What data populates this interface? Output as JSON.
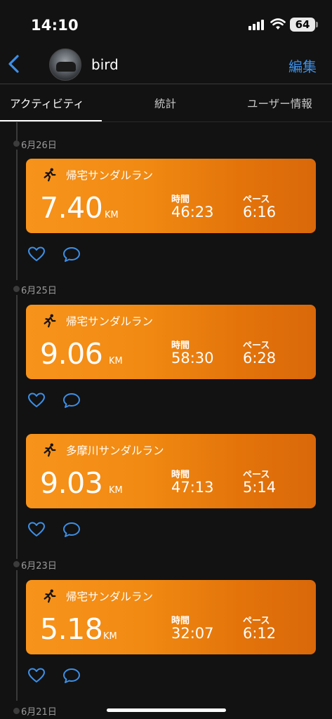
{
  "status_bar": {
    "time": "14:10",
    "battery": "64"
  },
  "header": {
    "username": "bird",
    "edit_label": "編集"
  },
  "tabs": [
    {
      "label": "アクティビティ",
      "active": true
    },
    {
      "label": "統計",
      "active": false
    },
    {
      "label": "ユーザー情報",
      "active": false
    }
  ],
  "labels": {
    "time": "時間",
    "pace": "ペース",
    "unit": "KM"
  },
  "dates": [
    "6月26日",
    "6月25日",
    "6月23日",
    "6月21日"
  ],
  "activities": [
    {
      "title": "帰宅サンダルラン",
      "distance": "7.40",
      "time": "46:23",
      "pace": "6:16"
    },
    {
      "title": "帰宅サンダルラン",
      "distance": "9.06",
      "time": "58:30",
      "pace": "6:28"
    },
    {
      "title": "多摩川サンダルラン",
      "distance": "9.03",
      "time": "47:13",
      "pace": "5:14"
    },
    {
      "title": "帰宅サンダルラン",
      "distance": "5.18",
      "time": "32:07",
      "pace": "6:12"
    }
  ],
  "colors": {
    "accent": "#3d8fe6",
    "card": "#f18a12",
    "background": "#121212"
  },
  "icons": [
    "back-chevron-icon",
    "runner-icon",
    "heart-icon",
    "comment-icon",
    "wifi-icon",
    "signal-icon"
  ]
}
